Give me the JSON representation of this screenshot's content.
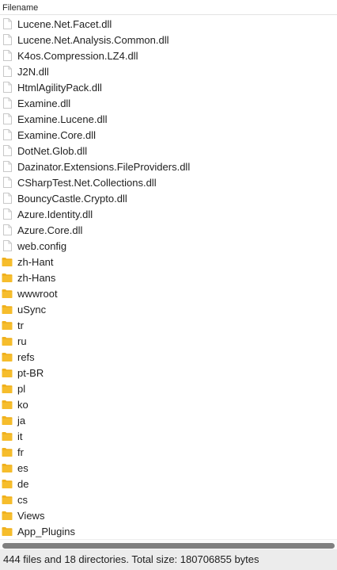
{
  "column_header": {
    "label": "Filename"
  },
  "colors": {
    "folder": "#f6bd2c",
    "folder_tab": "#f0b11e",
    "file_border": "#c8c8c8",
    "scroll_thumb": "#7f7f7f",
    "status_bg": "#ececec"
  },
  "entries": [
    {
      "name": "Lucene.Net.Facet.dll",
      "type": "file",
      "icon": "file-icon"
    },
    {
      "name": "Lucene.Net.Analysis.Common.dll",
      "type": "file",
      "icon": "file-icon"
    },
    {
      "name": "K4os.Compression.LZ4.dll",
      "type": "file",
      "icon": "file-icon"
    },
    {
      "name": "J2N.dll",
      "type": "file",
      "icon": "file-icon"
    },
    {
      "name": "HtmlAgilityPack.dll",
      "type": "file",
      "icon": "file-icon"
    },
    {
      "name": "Examine.dll",
      "type": "file",
      "icon": "file-icon"
    },
    {
      "name": "Examine.Lucene.dll",
      "type": "file",
      "icon": "file-icon"
    },
    {
      "name": "Examine.Core.dll",
      "type": "file",
      "icon": "file-icon"
    },
    {
      "name": "DotNet.Glob.dll",
      "type": "file",
      "icon": "file-icon"
    },
    {
      "name": "Dazinator.Extensions.FileProviders.dll",
      "type": "file",
      "icon": "file-icon"
    },
    {
      "name": "CSharpTest.Net.Collections.dll",
      "type": "file",
      "icon": "file-icon"
    },
    {
      "name": "BouncyCastle.Crypto.dll",
      "type": "file",
      "icon": "file-icon"
    },
    {
      "name": "Azure.Identity.dll",
      "type": "file",
      "icon": "file-icon"
    },
    {
      "name": "Azure.Core.dll",
      "type": "file",
      "icon": "file-icon"
    },
    {
      "name": "web.config",
      "type": "file",
      "icon": "file-icon"
    },
    {
      "name": "zh-Hant",
      "type": "folder",
      "icon": "folder-icon"
    },
    {
      "name": "zh-Hans",
      "type": "folder",
      "icon": "folder-icon"
    },
    {
      "name": "wwwroot",
      "type": "folder",
      "icon": "folder-icon"
    },
    {
      "name": "uSync",
      "type": "folder",
      "icon": "folder-icon"
    },
    {
      "name": "tr",
      "type": "folder",
      "icon": "folder-icon"
    },
    {
      "name": "ru",
      "type": "folder",
      "icon": "folder-icon"
    },
    {
      "name": "refs",
      "type": "folder",
      "icon": "folder-icon"
    },
    {
      "name": "pt-BR",
      "type": "folder",
      "icon": "folder-icon"
    },
    {
      "name": "pl",
      "type": "folder",
      "icon": "folder-icon"
    },
    {
      "name": "ko",
      "type": "folder",
      "icon": "folder-icon"
    },
    {
      "name": "ja",
      "type": "folder",
      "icon": "folder-icon"
    },
    {
      "name": "it",
      "type": "folder",
      "icon": "folder-icon"
    },
    {
      "name": "fr",
      "type": "folder",
      "icon": "folder-icon"
    },
    {
      "name": "es",
      "type": "folder",
      "icon": "folder-icon"
    },
    {
      "name": "de",
      "type": "folder",
      "icon": "folder-icon"
    },
    {
      "name": "cs",
      "type": "folder",
      "icon": "folder-icon"
    },
    {
      "name": "Views",
      "type": "folder",
      "icon": "folder-icon"
    },
    {
      "name": "App_Plugins",
      "type": "folder",
      "icon": "folder-icon"
    }
  ],
  "status": {
    "text": "444 files and 18 directories. Total size: 180706855 bytes"
  }
}
